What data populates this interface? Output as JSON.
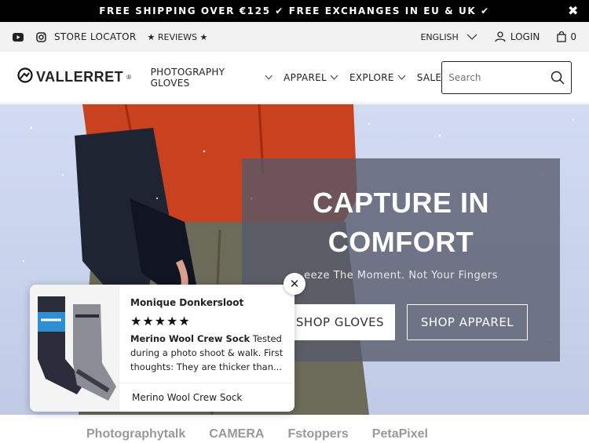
{
  "announcement": {
    "text": "FREE SHIPPING OVER €125 ✔ FREE EXCHANGES IN EU & UK ✔",
    "close": "✖"
  },
  "utility": {
    "store_locator": "STORE LOCATOR",
    "reviews": "★ REVIEWS ★",
    "language": "ENGLISH",
    "login": "LOGIN",
    "cart_count": "0"
  },
  "header": {
    "logo": "VALLERRET",
    "logo_mark": "®",
    "nav": [
      {
        "label": "PHOTOGRAPHY GLOVES"
      },
      {
        "label": "APPAREL"
      },
      {
        "label": "EXPLORE"
      },
      {
        "label": "SALE"
      }
    ],
    "search_placeholder": "Search"
  },
  "hero": {
    "title_line1": "CAPTURE IN",
    "title_line2": "COMFORT",
    "subtitle": "eeze The Moment. Not Your Fingers",
    "btn_gloves": "SHOP GLOVES",
    "btn_apparel": "SHOP APPAREL"
  },
  "review_popup": {
    "reviewer": "Monique Donkersloot",
    "stars": "★★★★★",
    "product_bold": "Merino Wool Crew Sock",
    "review": " Tested during a photo shoot & walk. First thoughts: They are thicker than...",
    "product": "Merino Wool Crew Sock",
    "close": "✕"
  },
  "press": {
    "logos": [
      "Photographytalk",
      "CAMERA",
      "Fstoppers",
      "PetaPixel"
    ]
  },
  "colors": {
    "announcement_bg": "#000000",
    "utility_bg": "#f2f2f2"
  }
}
